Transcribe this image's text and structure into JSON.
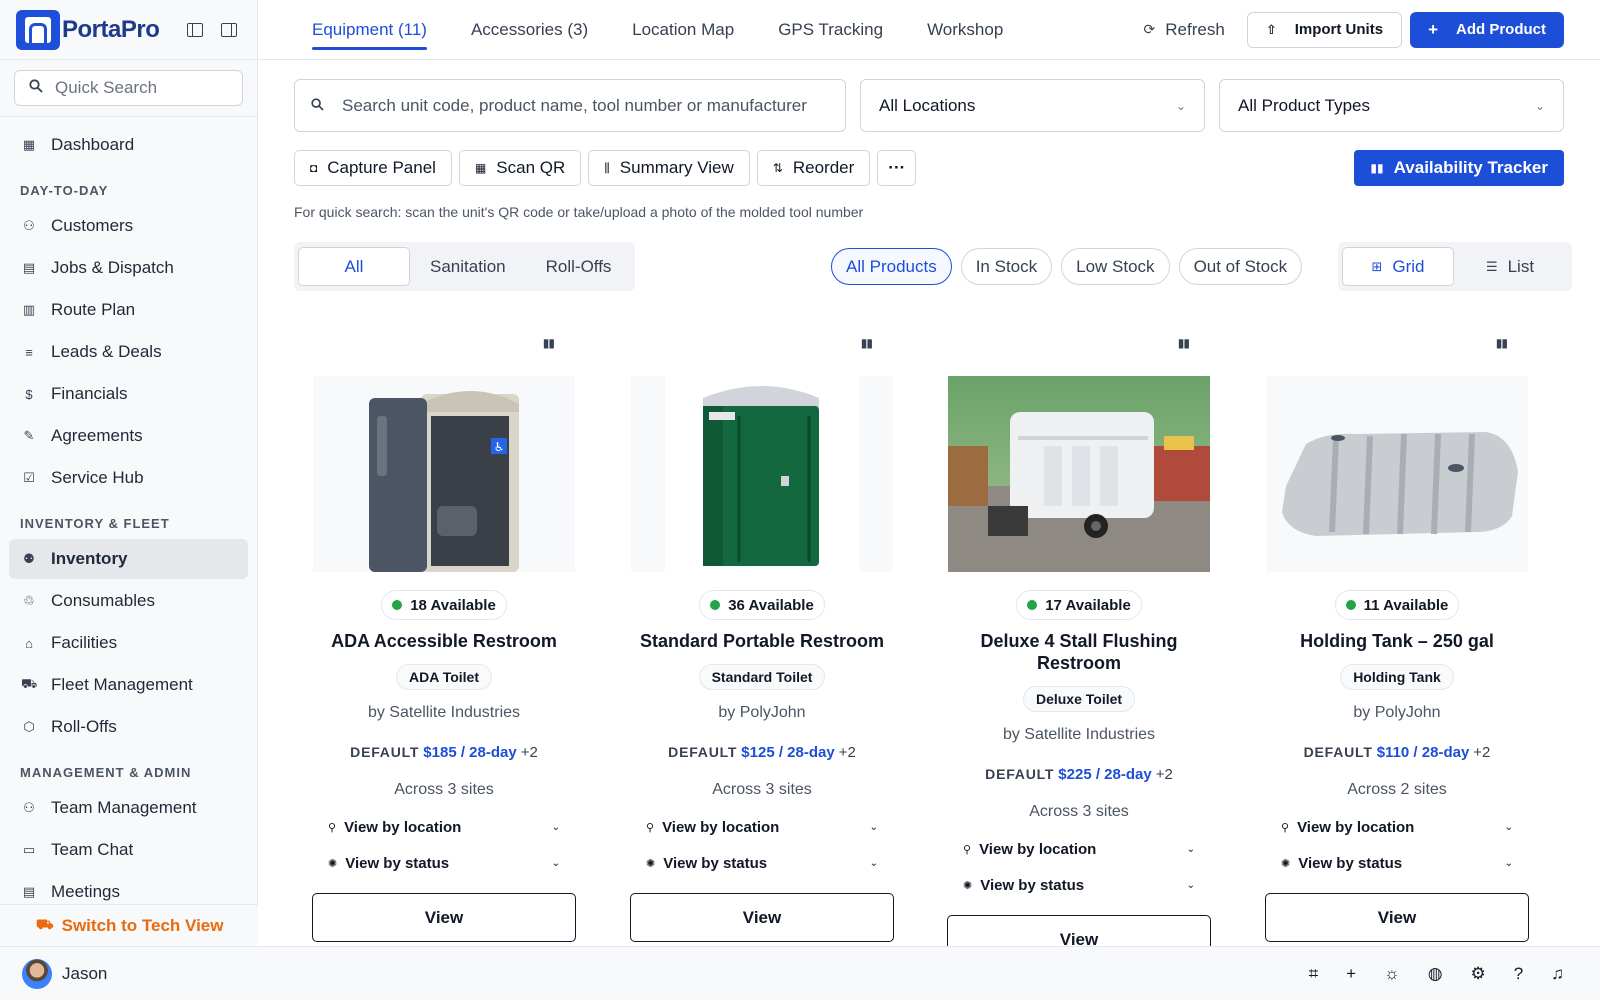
{
  "brand": {
    "name": "PortaPro"
  },
  "sidebar": {
    "quick_search_placeholder": "Quick Search",
    "top_items": [
      {
        "label": "Dashboard",
        "icon": "dashboard-icon"
      }
    ],
    "sections": [
      {
        "title": "DAY-TO-DAY",
        "items": [
          {
            "label": "Customers",
            "icon": "customers-icon"
          },
          {
            "label": "Jobs & Dispatch",
            "icon": "calendar-icon"
          },
          {
            "label": "Route Plan",
            "icon": "map-icon"
          },
          {
            "label": "Leads & Deals",
            "icon": "leads-icon"
          },
          {
            "label": "Financials",
            "icon": "dollar-icon"
          },
          {
            "label": "Agreements",
            "icon": "signature-icon"
          },
          {
            "label": "Service Hub",
            "icon": "checklist-icon"
          }
        ]
      },
      {
        "title": "INVENTORY & FLEET",
        "items": [
          {
            "label": "Inventory",
            "icon": "inventory-icon",
            "active": true
          },
          {
            "label": "Consumables",
            "icon": "consumables-icon"
          },
          {
            "label": "Facilities",
            "icon": "facilities-icon"
          },
          {
            "label": "Fleet Management",
            "icon": "truck-icon"
          },
          {
            "label": "Roll-Offs",
            "icon": "box-icon"
          }
        ]
      },
      {
        "title": "MANAGEMENT & ADMIN",
        "items": [
          {
            "label": "Team Management",
            "icon": "team-icon"
          },
          {
            "label": "Team Chat",
            "icon": "chat-icon"
          },
          {
            "label": "Meetings",
            "icon": "meetings-icon"
          }
        ]
      }
    ],
    "switch_label": "Switch to Tech View"
  },
  "user": {
    "name": "Jason"
  },
  "topnav": {
    "tabs": [
      "Equipment (11)",
      "Accessories (3)",
      "Location Map",
      "GPS Tracking",
      "Workshop"
    ],
    "active_tab": 0,
    "refresh_label": "Refresh",
    "import_label": "Import Units",
    "add_label": "Add Product"
  },
  "filters": {
    "search_placeholder": "Search unit code, product name, tool number or manufacturer",
    "location_value": "All Locations",
    "type_value": "All Product Types"
  },
  "tools": {
    "capture": "Capture Panel",
    "scan": "Scan QR",
    "summary": "Summary View",
    "reorder": "Reorder",
    "more": "···",
    "availability": "Availability Tracker",
    "hint": "For quick search: scan the unit's QR code or take/upload a photo of the molded tool number"
  },
  "segments": [
    "All",
    "Sanitation",
    "Roll-Offs"
  ],
  "stock_pills": [
    "All Products",
    "In Stock",
    "Low Stock",
    "Out of Stock"
  ],
  "view_toggle": {
    "grid": "Grid",
    "list": "List"
  },
  "products": [
    {
      "available": "18 Available",
      "name": "ADA Accessible Restroom",
      "type": "ADA Toilet",
      "maker": "by Satellite Industries",
      "price_label": "DEFAULT",
      "price": "$185 / 28-day",
      "extra": "+2",
      "sites": "Across 3 sites"
    },
    {
      "available": "36 Available",
      "name": "Standard Portable Restroom",
      "type": "Standard Toilet",
      "maker": "by PolyJohn",
      "price_label": "DEFAULT",
      "price": "$125 / 28-day",
      "extra": "+2",
      "sites": "Across 3 sites"
    },
    {
      "available": "17 Available",
      "name": "Deluxe 4 Stall Flushing Restroom",
      "type": "Deluxe Toilet",
      "maker": "by Satellite Industries",
      "price_label": "DEFAULT",
      "price": "$225 / 28-day",
      "extra": "+2",
      "sites": "Across 3 sites"
    },
    {
      "available": "11 Available",
      "name": "Holding Tank – 250 gal",
      "type": "Holding Tank",
      "maker": "by PolyJohn",
      "price_label": "DEFAULT",
      "price": "$110 / 28-day",
      "extra": "+2",
      "sites": "Across 2 sites"
    }
  ],
  "card_labels": {
    "by_location": "View by location",
    "by_status": "View by status",
    "view": "View"
  },
  "colors": {
    "primary": "#1d4ed8",
    "available_dot": "#22a447",
    "switch_orange": "#ea6a0c"
  }
}
